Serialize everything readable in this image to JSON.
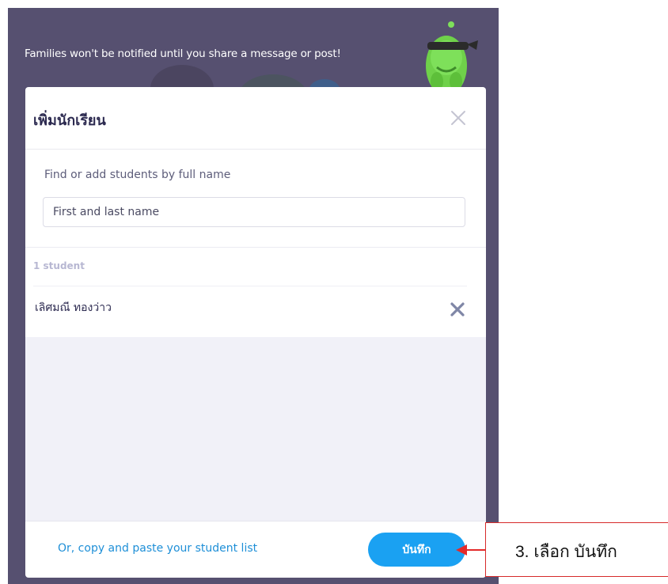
{
  "banner": {
    "text": "Families won't be notified until you share a message or post!"
  },
  "modal": {
    "title": "เพิ่มนักเรียน",
    "find_label": "Find or add students by full name",
    "input_placeholder": "First and last name",
    "input_value": "",
    "student_count": "1 student",
    "students": [
      {
        "name": "เลิศมณี ทองว่าว"
      }
    ],
    "copy_link": "Or, copy and paste your student list",
    "save_label": "บันทึก"
  },
  "icons": {
    "close": "close-icon",
    "remove": "remove-student-icon",
    "mascot": "monster-mascot"
  },
  "annotation": {
    "text": "3. เลือก บันทึก"
  },
  "colors": {
    "backdrop": "#565070",
    "accent": "#1aa1f2",
    "link": "#1e8fd7",
    "annotation": "#e32b2b"
  }
}
